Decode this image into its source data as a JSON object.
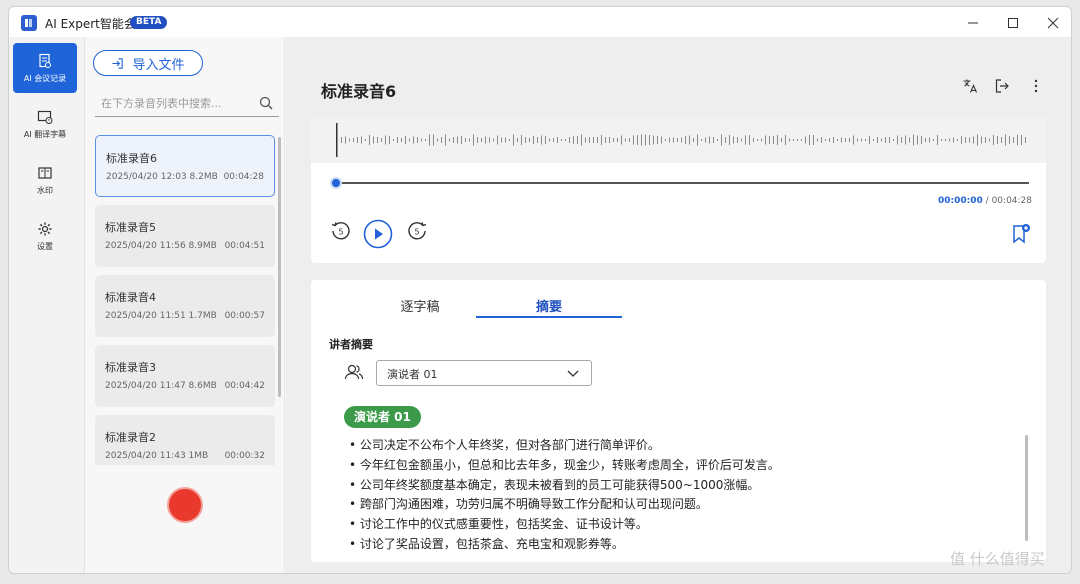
{
  "window": {
    "title": "AI Expert智能会议",
    "badge": "BETA"
  },
  "nav": {
    "items": [
      {
        "label": "AI 会议记录",
        "icon": "document-icon",
        "active": true
      },
      {
        "label": "AI 翻译字幕",
        "icon": "screen-clock-icon",
        "active": false
      },
      {
        "label": "水印",
        "icon": "book-icon",
        "active": false
      },
      {
        "label": "设置",
        "icon": "gear-icon",
        "active": false
      }
    ]
  },
  "list": {
    "import_label": "导入文件",
    "search_placeholder": "在下方录音列表中搜索...",
    "recordings": [
      {
        "name": "标准录音6",
        "date": "2025/04/20 12:03",
        "size": "8.2MB",
        "duration": "00:04:28"
      },
      {
        "name": "标准录音5",
        "date": "2025/04/20 11:56",
        "size": "8.9MB",
        "duration": "00:04:51"
      },
      {
        "name": "标准录音4",
        "date": "2025/04/20 11:51",
        "size": "1.7MB",
        "duration": "00:00:57"
      },
      {
        "name": "标准录音3",
        "date": "2025/04/20 11:47",
        "size": "8.6MB",
        "duration": "00:04:42"
      },
      {
        "name": "标准录音2",
        "date": "2025/04/20 11:43",
        "size": "1MB",
        "duration": "00:00:32"
      }
    ]
  },
  "main": {
    "title": "标准录音6",
    "player": {
      "current_time": "00:00:00",
      "separator": "/",
      "total_time": "00:04:28",
      "progress": 0
    },
    "tabs": [
      {
        "label": "逐字稿",
        "active": false
      },
      {
        "label": "摘要",
        "active": true
      }
    ],
    "section_label": "讲者摘要",
    "speaker_select": "演说者 01",
    "speaker_badge": "演说者 01",
    "summary": [
      "公司决定不公布个人年终奖，但对各部门进行简单评价。",
      "今年红包金额虽小，但总和比去年多，现金少，转账考虑周全，评价后可发言。",
      "公司年终奖额度基本确定，表现未被看到的员工可能获得500~1000涨幅。",
      "跨部门沟通困难，功劳归属不明确导致工作分配和认可出现问题。",
      "讨论工作中的仪式感重要性，包括奖金、证书设计等。",
      "讨论了奖品设置，包括茶盒、充电宝和观影券等。"
    ]
  },
  "watermark": "值 什么值得买",
  "colors": {
    "accent": "#2163d6",
    "record": "#e8392c",
    "speaker_badge": "#3b9b4a"
  }
}
